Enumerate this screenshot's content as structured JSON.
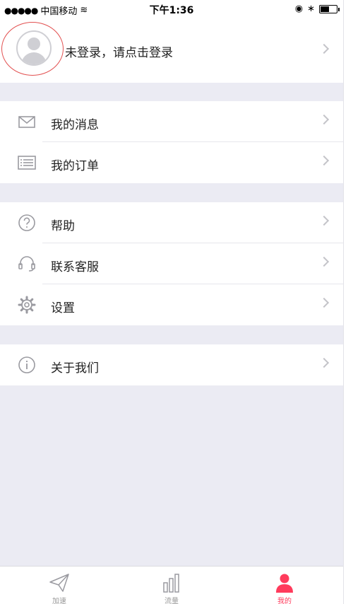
{
  "status_bar": {
    "signal_dots": "●●●●●",
    "carrier": "中国移动",
    "wifi_glyph": "≋",
    "time": "下午1:36",
    "lock_glyph": "◉",
    "bluetooth_glyph": "∗"
  },
  "profile": {
    "login_prompt": "未登录，请点击登录"
  },
  "menu": {
    "messages": "我的消息",
    "orders": "我的订单",
    "help": "帮助",
    "contact_service": "联系客服",
    "settings": "设置",
    "about_us": "关于我们"
  },
  "tabbar": {
    "items": [
      {
        "label": "加速",
        "icon": "paper-plane-icon",
        "active": false
      },
      {
        "label": "流量",
        "icon": "bar-chart-icon",
        "active": false
      },
      {
        "label": "我的",
        "icon": "user-icon",
        "active": true
      }
    ]
  },
  "colors": {
    "accent": "#ff3b5c",
    "background": "#ebebf3",
    "icon_gray": "#9a9aa0"
  }
}
